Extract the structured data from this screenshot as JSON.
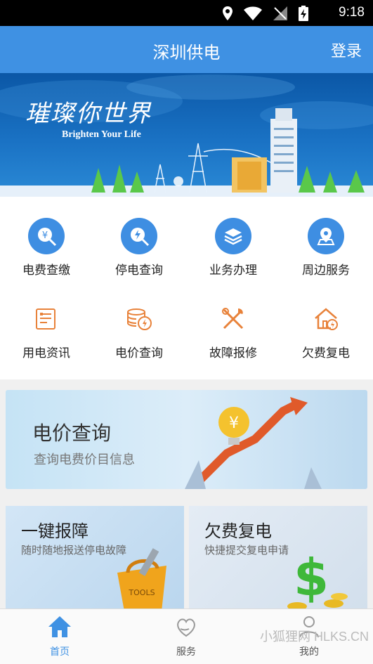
{
  "statusbar": {
    "time": "9:18"
  },
  "appbar": {
    "title": "深圳供电",
    "login": "登录"
  },
  "banner": {
    "title": "璀璨你世界",
    "subtitle": "Brighten Your Life"
  },
  "grid": [
    {
      "label": "电费查缴",
      "icon": "bill-payment-icon"
    },
    {
      "label": "停电查询",
      "icon": "outage-search-icon"
    },
    {
      "label": "业务办理",
      "icon": "layers-icon"
    },
    {
      "label": "周边服务",
      "icon": "map-pin-icon"
    },
    {
      "label": "用电资讯",
      "icon": "news-icon"
    },
    {
      "label": "电价查询",
      "icon": "coins-icon"
    },
    {
      "label": "故障报修",
      "icon": "tools-icon"
    },
    {
      "label": "欠费复电",
      "icon": "house-power-icon"
    }
  ],
  "cards": {
    "price": {
      "title": "电价查询",
      "subtitle": "查询电费价目信息"
    },
    "repair": {
      "title": "一键报障",
      "subtitle": "随时随地报送停电故障"
    },
    "restore": {
      "title": "欠费复电",
      "subtitle": "快捷提交复电申请"
    }
  },
  "tabs": [
    {
      "label": "首页",
      "icon": "home-icon"
    },
    {
      "label": "服务",
      "icon": "heart-hands-icon"
    },
    {
      "label": "我的",
      "icon": "user-icon"
    }
  ],
  "watermark": "小狐狸网 HLKS.CN",
  "colors": {
    "primary": "#3f91e3",
    "iconOrange": "#e8823a"
  }
}
